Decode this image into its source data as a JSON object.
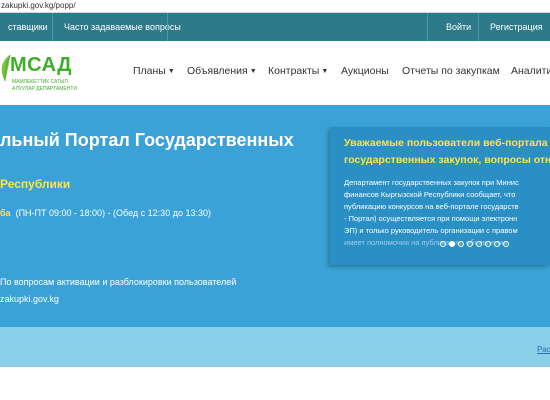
{
  "browser": {
    "url": "zakupki.gov.kg/popp/"
  },
  "topbar": {
    "left_items": [
      "ставщики",
      "Часто задаваемые вопросы"
    ],
    "right_items": [
      "Войти",
      "Регистрация"
    ]
  },
  "logo": {
    "text": "МСАД",
    "sub1": "МАМЛЕКЕТТИК САТЫП",
    "sub2": "АЛУУЛАР ДЕПАРТАМЕНТИ"
  },
  "nav": {
    "items": [
      {
        "label": "Планы",
        "has_caret": true
      },
      {
        "label": "Объявления",
        "has_caret": true
      },
      {
        "label": "Контракты",
        "has_caret": true
      },
      {
        "label": "Аукционы",
        "has_caret": false
      },
      {
        "label": "Отчеты по закупкам",
        "has_caret": false
      },
      {
        "label": "Аналити",
        "has_caret": false
      }
    ]
  },
  "hero": {
    "title": "льный Портал Государственных",
    "subtitle": "Республики",
    "hours_label": "ба",
    "hours_text": "(ПН-ПТ 09:00 - 18:00) - (Обед с 12:30 до 13:30)",
    "activation_text": "По вопросам активации и разблокировки пользователей",
    "site_text": "zakupki.gov.kg"
  },
  "notice": {
    "title_line1": "Уважаемые пользователи веб-портала",
    "title_line2": "государственных закупок, вопросы отн",
    "lines": [
      "Департамент государственных закупок при Минис",
      "финансов Кыргызской Республики сообщает, что",
      "публикацию конкурсов на веб-портале государств",
      "- Портал) осуществляется при помощи электронн",
      "ЭП) и только руководитель организации с правом",
      "имеет полномочия на публикацию объявления"
    ],
    "slide_count": 8,
    "active_slide": 1
  },
  "band": {
    "link_text": "Рас"
  },
  "colors": {
    "topbar": "#2d7a8a",
    "hero": "#3aa2d6",
    "notice": "#2a8fc4",
    "accent_yellow": "#ffe24a",
    "logo_green": "#3fae2a",
    "band": "#8ccfe8"
  }
}
